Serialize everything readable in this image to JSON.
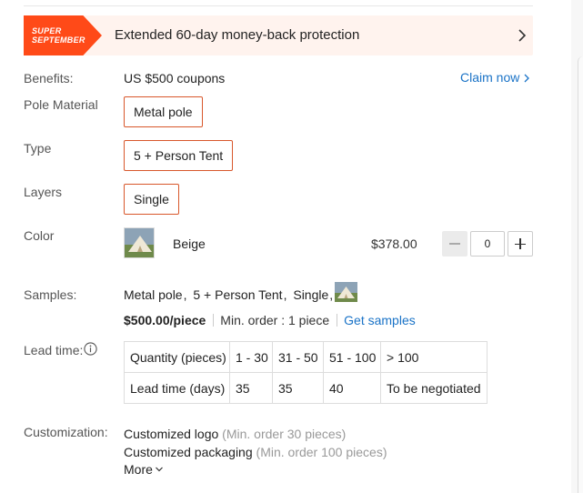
{
  "banner": {
    "badge_line1": "SUPER",
    "badge_line2": "SEPTEMBER",
    "text": "Extended 60-day money-back protection",
    "chevron_icon": "chevron-right-icon"
  },
  "benefits": {
    "label": "Benefits:",
    "value": "US $500 coupons",
    "claim": "Claim now"
  },
  "pole_material": {
    "label": "Pole Material",
    "option": "Metal pole"
  },
  "type": {
    "label": "Type",
    "option": "5 + Person Tent"
  },
  "layers": {
    "label": "Layers",
    "option": "Single"
  },
  "color": {
    "label": "Color",
    "name": "Beige",
    "price": "$378.00",
    "quantity": "0"
  },
  "samples": {
    "label": "Samples:",
    "items": [
      "Metal pole",
      "5 + Person Tent",
      "Single"
    ],
    "price": "$500.00/piece",
    "min_order": "Min. order : 1 piece",
    "get_samples": "Get samples"
  },
  "lead_time": {
    "label": "Lead time:",
    "headers": [
      "Quantity (pieces)",
      "1 - 30",
      "31 - 50",
      "51 - 100",
      "> 100"
    ],
    "row": [
      "Lead time (days)",
      "35",
      "35",
      "40",
      "To be negotiated"
    ]
  },
  "customization": {
    "label": "Customization:",
    "items": [
      {
        "name": "Customized logo",
        "note": "(Min. order 30 pieces)"
      },
      {
        "name": "Customized packaging",
        "note": "(Min. order 100 pieces)"
      }
    ],
    "more": "More"
  },
  "colors": {
    "accent": "#ff4a18",
    "link": "#1a73c7",
    "option_border": "#d8572b"
  }
}
